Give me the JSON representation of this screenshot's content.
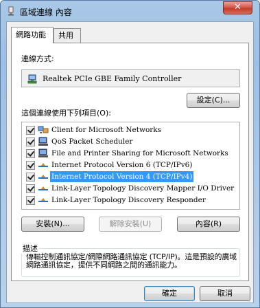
{
  "window": {
    "title": "區域連線 內容",
    "close_glyph": "✕"
  },
  "tabs": [
    {
      "label": "網路功能",
      "active": true
    },
    {
      "label": "共用",
      "active": false
    }
  ],
  "connect_using": {
    "label": "連線方式:",
    "adapter": "Realtek PCIe GBE Family Controller",
    "configure_button": "設定(C)..."
  },
  "items_section": {
    "label": "這個連線使用下列項目(O):",
    "items": [
      {
        "label": "Client for Microsoft Networks",
        "checked": true,
        "icon": "network-client-icon",
        "selected": false
      },
      {
        "label": "QoS Packet Scheduler",
        "checked": true,
        "icon": "service-icon",
        "selected": false
      },
      {
        "label": "File and Printer Sharing for Microsoft Networks",
        "checked": true,
        "icon": "service-icon",
        "selected": false
      },
      {
        "label": "Internet Protocol Version 6 (TCP/IPv6)",
        "checked": true,
        "icon": "protocol-icon",
        "selected": false
      },
      {
        "label": "Internet Protocol Version 4 (TCP/IPv4)",
        "checked": true,
        "icon": "protocol-icon",
        "selected": true
      },
      {
        "label": "Link-Layer Topology Discovery Mapper I/O Driver",
        "checked": true,
        "icon": "protocol-icon",
        "selected": false
      },
      {
        "label": "Link-Layer Topology Discovery Responder",
        "checked": true,
        "icon": "protocol-icon",
        "selected": false
      }
    ]
  },
  "item_buttons": {
    "install": "安裝(N)...",
    "uninstall": "解除安裝(U)",
    "properties": "內容(R)"
  },
  "description": {
    "legend": "描述",
    "text": "傳輸控制通訊協定/網際網路通訊協定 (TCP/IP)。這是預設的廣域網路通訊協定，提供不同網路之間的通訊能力。"
  },
  "footer": {
    "ok": "確定",
    "cancel": "取消"
  },
  "colors": {
    "selection": "#3399ff",
    "close_button": "#c33b2a"
  }
}
